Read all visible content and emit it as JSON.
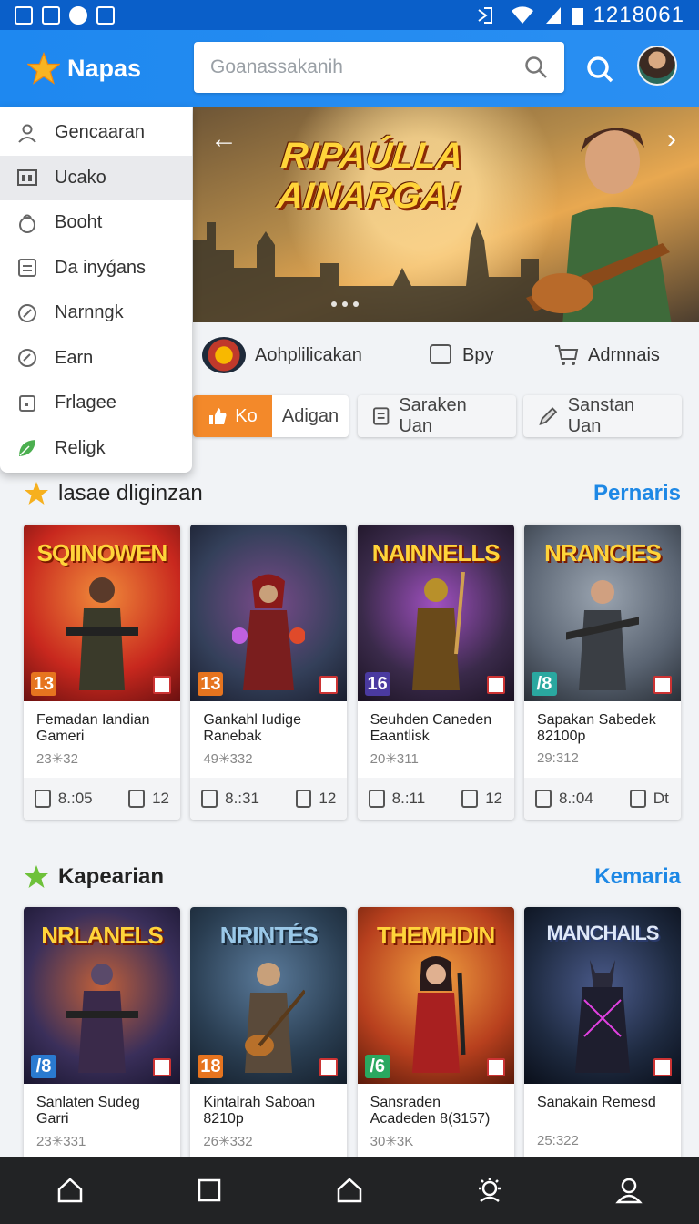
{
  "status_bar": {
    "time": "1218061"
  },
  "header": {
    "app_name": "Napas",
    "search_placeholder": "Goanassakanih"
  },
  "menu": {
    "items": [
      {
        "label": "Gencaaran",
        "icon": "user-icon",
        "active": false
      },
      {
        "label": "Ucako",
        "icon": "grid-icon",
        "active": true
      },
      {
        "label": "Booht",
        "icon": "bag-icon",
        "active": false
      },
      {
        "label": "Da inyǵans",
        "icon": "document-icon",
        "active": false
      },
      {
        "label": "Narnngk",
        "icon": "compass-icon",
        "active": false
      },
      {
        "label": "Earn",
        "icon": "badge-icon",
        "active": false
      },
      {
        "label": "Frlagee",
        "icon": "square-icon",
        "active": false
      },
      {
        "label": "Religk",
        "icon": "leaf-icon",
        "active": false
      }
    ]
  },
  "hero": {
    "title_line1": "RIPAÚLLA",
    "title_line2": "AINARGA!"
  },
  "categories": [
    {
      "label": "Aohplilicakan",
      "icon": "game-logo-icon"
    },
    {
      "label": "Bpy",
      "icon": "square-chat-icon"
    },
    {
      "label": "Adrnnais",
      "icon": "cart-icon"
    }
  ],
  "chips": {
    "active_label": "Ko",
    "plain_label": "Adigan",
    "secondary": [
      {
        "label": "Saraken Uan",
        "icon": "list-icon"
      },
      {
        "label": "Sanstan Uan",
        "icon": "pen-icon"
      }
    ]
  },
  "sections": [
    {
      "title": "lasae dliginzan",
      "more": "Pernaris",
      "star_color": "#f6b01e",
      "cards": [
        {
          "art_title": "SQIINOWEN",
          "rating": "13",
          "name": "Femadan Iandian Gameri",
          "count": "23✳32",
          "stat1": "8.:05",
          "stat2": "12",
          "bg": "#c8281e",
          "rating_color": "#e6741f"
        },
        {
          "art_title": "",
          "rating": "13",
          "name": "Gankahl Iudige Ranebak",
          "count": "49✳332",
          "stat1": "8.:31",
          "stat2": "12",
          "bg": "#34405a",
          "rating_color": "#e6741f"
        },
        {
          "art_title": "NAINNELLS",
          "rating": "16",
          "name": "Seuhden Caneden Eaantlisk",
          "count": "20✳311",
          "stat1": "8.:11",
          "stat2": "12",
          "bg": "#3a2a4a",
          "rating_color": "#4a3aa0"
        },
        {
          "art_title": "NRANCIES",
          "rating": "/8",
          "name": "Sapakan Sabedek 82100p",
          "count": "29:312",
          "stat1": "8.:04",
          "stat2": "Dt",
          "bg": "#5a6472",
          "rating_color": "#2aa8a0"
        }
      ]
    },
    {
      "title": "Kapearian",
      "more": "Kemaria",
      "star_color": "#6ec13a",
      "cards": [
        {
          "art_title": "NRLANELS",
          "rating": "/8",
          "name": "Sanlaten Sudeg Garri",
          "count": "23✳331",
          "stat1": "",
          "stat2": "",
          "bg": "#3a2f5a",
          "rating_color": "#2a7ad0"
        },
        {
          "art_title": "NRINTÉS",
          "rating": "18",
          "name": "Kintalrah Saboan 8210p",
          "count": "26✳332",
          "stat1": "",
          "stat2": "",
          "bg": "#2a3e52",
          "rating_color": "#e6741f"
        },
        {
          "art_title": "THEMHDIN",
          "rating": "/6",
          "name": "Sansraden Acadeden 8(3157)",
          "count": "30✳3K",
          "stat1": "",
          "stat2": "",
          "bg": "#b8401e",
          "rating_color": "#2aa860"
        },
        {
          "art_title": "MANCHAILS",
          "rating": "",
          "name": "Sanakain Remesd",
          "count": "25:322",
          "stat1": "",
          "stat2": "",
          "bg": "#1e2a40",
          "rating_color": "#1e2a40"
        }
      ]
    }
  ],
  "bottom_nav": [
    {
      "icon": "home-icon"
    },
    {
      "icon": "square-icon"
    },
    {
      "icon": "home-outline-icon"
    },
    {
      "icon": "sun-icon"
    },
    {
      "icon": "profile-icon"
    }
  ]
}
